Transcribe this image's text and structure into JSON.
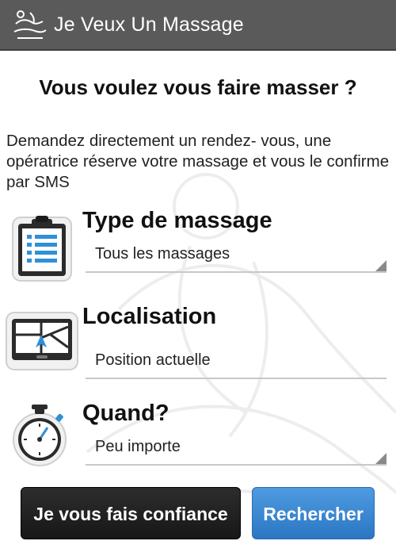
{
  "app_bar": {
    "title": "Je Veux Un Massage",
    "logo_icon": "massage-logo-icon"
  },
  "main": {
    "headline": "Vous voulez vous faire masser ?",
    "intro": "Demandez directement un rendez- vous, une opératrice réserve votre massage et vous le confirme par SMS"
  },
  "form": {
    "type": {
      "label": "Type de massage",
      "value": "Tous les massages",
      "icon": "clipboard-icon"
    },
    "location": {
      "label": "Localisation",
      "value": "Position actuelle",
      "icon": "gps-map-icon"
    },
    "when": {
      "label": "Quand?",
      "value": "Peu importe",
      "icon": "stopwatch-icon"
    }
  },
  "actions": {
    "trust_label": "Je vous fais confiance",
    "search_label": "Rechercher"
  },
  "colors": {
    "app_bar": "#5a5a5a",
    "primary_button": "#3a87d2",
    "dark_button": "#1f1f1f"
  }
}
